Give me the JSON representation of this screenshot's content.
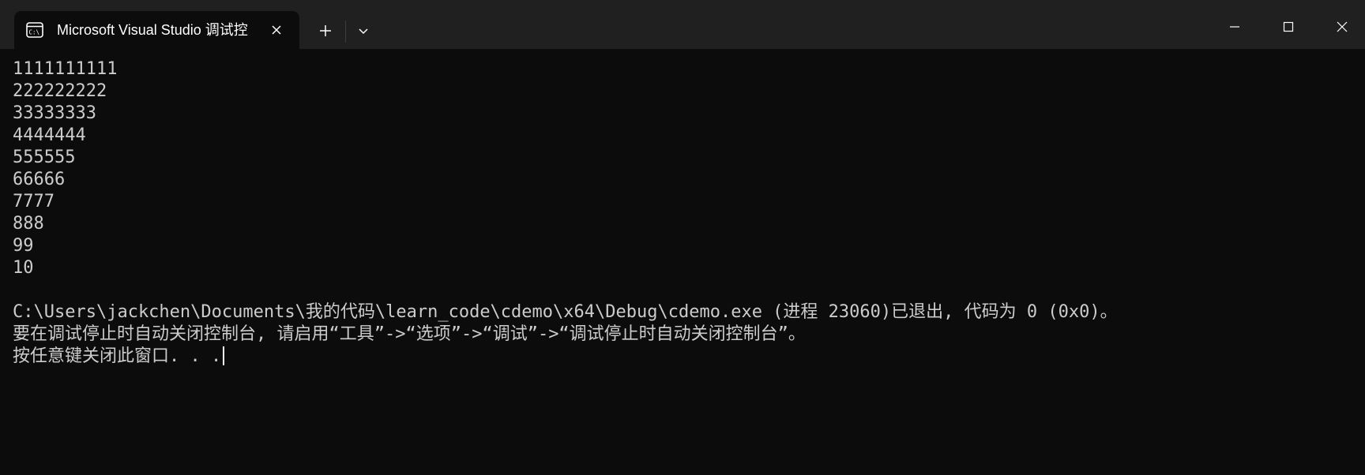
{
  "window": {
    "tab_title": "Microsoft Visual Studio 调试控",
    "tab_icon": "console-icon",
    "new_tab_icon": "plus-icon",
    "dropdown_icon": "chevron-down-icon",
    "minimize_icon": "minimize-icon",
    "maximize_icon": "maximize-icon",
    "close_icon": "close-icon"
  },
  "console": {
    "output_lines": [
      "1111111111",
      "222222222",
      "33333333",
      "4444444",
      "555555",
      "66666",
      "7777",
      "888",
      "99",
      "10"
    ],
    "exit_message": "C:\\Users\\jackchen\\Documents\\我的代码\\learn_code\\cdemo\\x64\\Debug\\cdemo.exe (进程 23060)已退出, 代码为 0 (0x0)。",
    "hint_message": "要在调试停止时自动关闭控制台, 请启用“工具”->“选项”->“调试”->“调试停止时自动关闭控制台”。",
    "prompt": "按任意键关闭此窗口. . ."
  },
  "colors": {
    "titlebar_bg": "#202020",
    "console_bg": "#0c0c0c",
    "console_text": "#cccccc",
    "title_text": "#ffffff"
  }
}
